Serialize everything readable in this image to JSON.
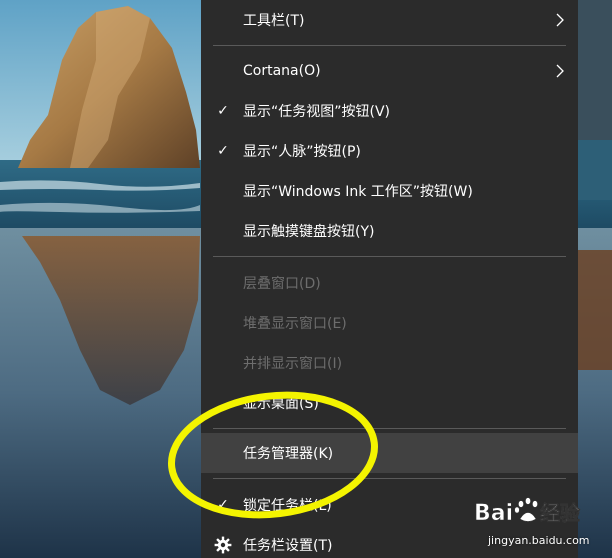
{
  "colors": {
    "menu_bg": "#2b2b2b",
    "menu_highlight": "#414141",
    "text": "#ffffff",
    "text_disabled": "#6d6d6d",
    "separator": "#5a5a5a",
    "annotation": "#ffff00"
  },
  "menu": {
    "items": [
      {
        "label": "工具栏(T)",
        "checked": false,
        "enabled": true,
        "submenu": true
      },
      {
        "label": "Cortana(O)",
        "checked": false,
        "enabled": true,
        "submenu": true
      },
      {
        "label": "显示“任务视图”按钮(V)",
        "checked": true,
        "enabled": true
      },
      {
        "label": "显示“人脉”按钮(P)",
        "checked": true,
        "enabled": true
      },
      {
        "label": "显示“Windows Ink 工作区”按钮(W)",
        "checked": false,
        "enabled": true
      },
      {
        "label": "显示触摸键盘按钮(Y)",
        "checked": false,
        "enabled": true
      },
      {
        "label": "层叠窗口(D)",
        "checked": false,
        "enabled": false
      },
      {
        "label": "堆叠显示窗口(E)",
        "checked": false,
        "enabled": false
      },
      {
        "label": "并排显示窗口(I)",
        "checked": false,
        "enabled": false
      },
      {
        "label": "显示桌面(S)",
        "checked": false,
        "enabled": true
      },
      {
        "label": "任务管理器(K)",
        "checked": false,
        "enabled": true,
        "highlighted": true
      },
      {
        "label": "锁定任务栏(L)",
        "checked": true,
        "enabled": true
      },
      {
        "label": "任务栏设置(T)",
        "checked": false,
        "enabled": true,
        "icon": "gear-icon"
      }
    ],
    "check_glyph": "✓"
  },
  "watermark": {
    "logo_text": "Bai",
    "logo_text2": "经验",
    "url": "jingyan.baidu.com"
  }
}
